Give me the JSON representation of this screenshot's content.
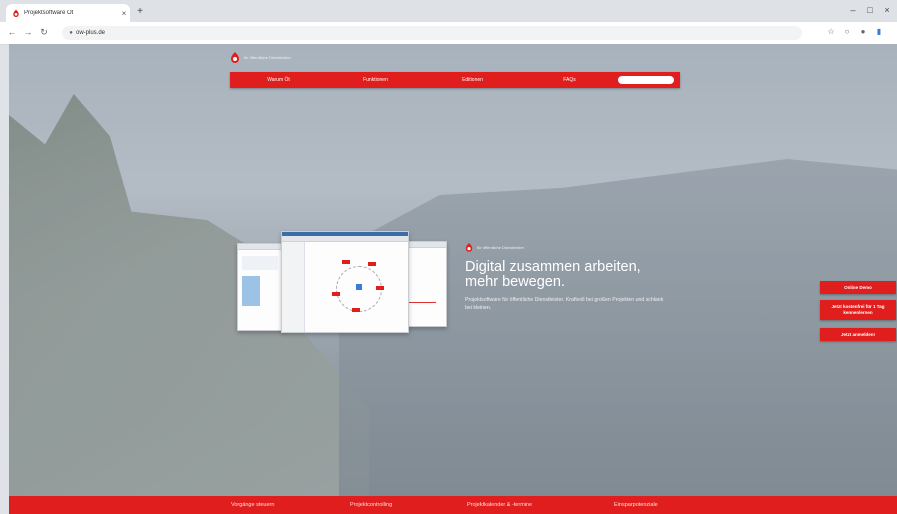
{
  "browser": {
    "tab_title": "Projektsoftware Öt",
    "tab_close": "×",
    "new_tab": "+",
    "url": "ow-plus.de",
    "window_controls": [
      "–",
      "□",
      "×"
    ],
    "nav_icons": [
      "back-arrow-icon",
      "forward-arrow-icon",
      "reload-icon"
    ]
  },
  "site": {
    "tagline": "für öffentliche Dienstleister",
    "nav": [
      "Warum Öt",
      "Funktionen",
      "Editionen",
      "FAQs"
    ],
    "search_placeholder": "",
    "hero_tagline": "für öffentliche Dienstleister",
    "headline_line1": "Digital zusammen arbeiten,",
    "headline_line2": "mehr bewegen.",
    "subtext": "Projektsoftware für öffentliche Dienstleister. Kraftvoll bei großen Projekten und schlank bei kleinen.",
    "side_buttons": {
      "demo": "Online Demo",
      "trial": "Jetzt kostenfrei für 1 Tag kennenlernen",
      "register": "Jetzt anmelden!"
    },
    "footer": [
      "Vorgänge steuern",
      "Projektcontrolling",
      "Projektkalender & -termine",
      "Einsparpotenziale"
    ],
    "accent_color": "#e01e1e"
  }
}
